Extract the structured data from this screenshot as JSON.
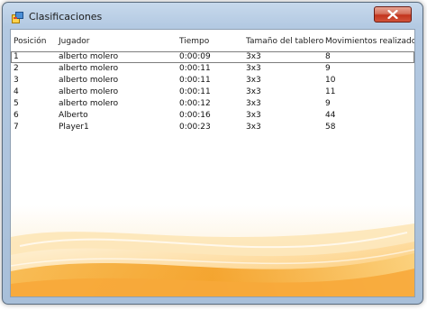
{
  "window": {
    "title": "Clasificaciones"
  },
  "columns": [
    "Posición",
    "Jugador",
    "Tiempo",
    "Tamaño del tablero",
    "Movimientos realizados"
  ],
  "rows": [
    [
      "1",
      "alberto molero",
      "0:00:09",
      "3x3",
      "8"
    ],
    [
      "2",
      "alberto molero",
      "0:00:11",
      "3x3",
      "9"
    ],
    [
      "3",
      "alberto molero",
      "0:00:11",
      "3x3",
      "10"
    ],
    [
      "4",
      "alberto molero",
      "0:00:11",
      "3x3",
      "11"
    ],
    [
      "5",
      "alberto molero",
      "0:00:12",
      "3x3",
      "9"
    ],
    [
      "6",
      "Alberto",
      "0:00:16",
      "3x3",
      "44"
    ],
    [
      "7",
      "Player1",
      "0:00:23",
      "3x3",
      "58"
    ]
  ],
  "icons": {
    "app": "app-icon",
    "close": "close-icon"
  },
  "colors": {
    "accent_orange": "#f39c1e",
    "close_red": "#c2341d"
  }
}
